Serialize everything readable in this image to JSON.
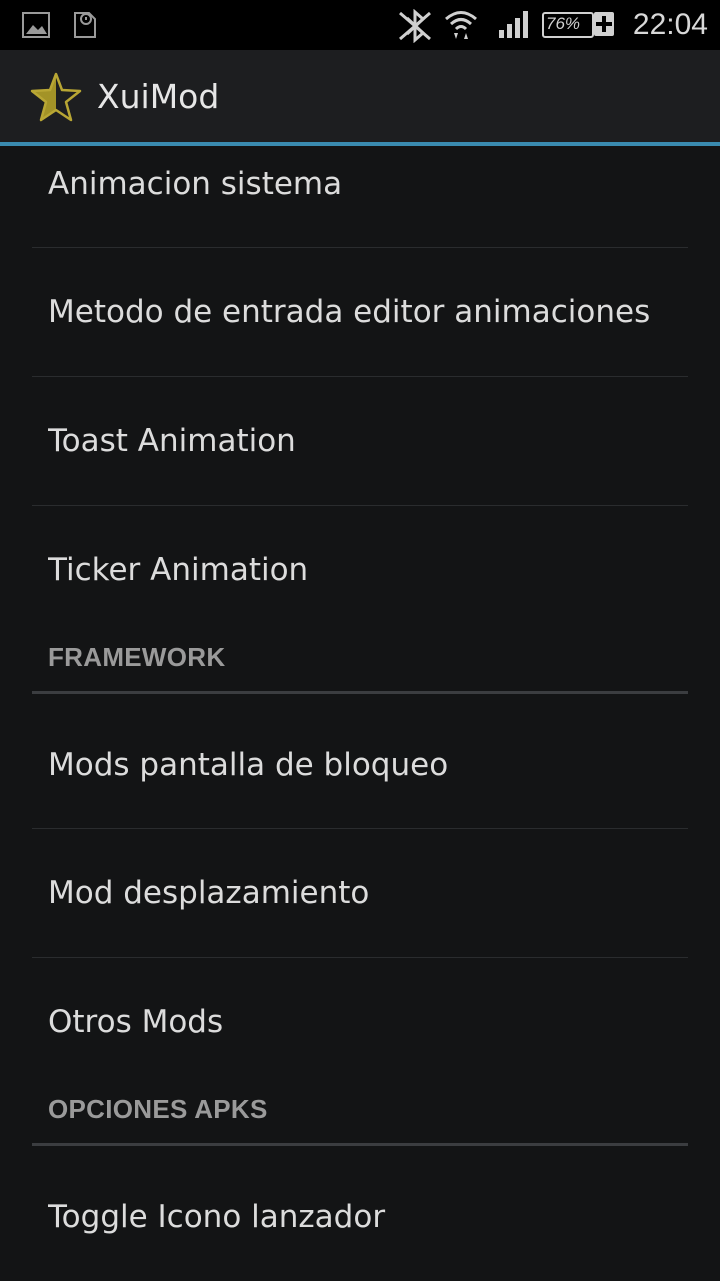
{
  "status_bar": {
    "battery_percent": "76%",
    "time": "22:04",
    "icons": [
      "picture-icon",
      "sim-icon",
      "bluetooth-icon",
      "wifi-icon",
      "signal-icon",
      "battery-icon"
    ]
  },
  "action_bar": {
    "app_icon": "star-icon",
    "title": "XuiMod",
    "accent_color": "#3a8bb0"
  },
  "list": {
    "items_top": [
      {
        "label": "Animacion sistema"
      },
      {
        "label": "Metodo de entrada editor animaciones"
      },
      {
        "label": "Toast Animation"
      },
      {
        "label": "Ticker Animation"
      }
    ],
    "section_framework": "FRAMEWORK",
    "items_framework": [
      {
        "label": "Mods pantalla de bloqueo"
      },
      {
        "label": "Mod desplazamiento"
      },
      {
        "label": "Otros Mods"
      }
    ],
    "section_apks": "OPCIONES APKS",
    "items_apks": [
      {
        "label": "Toggle Icono lanzador"
      }
    ]
  }
}
